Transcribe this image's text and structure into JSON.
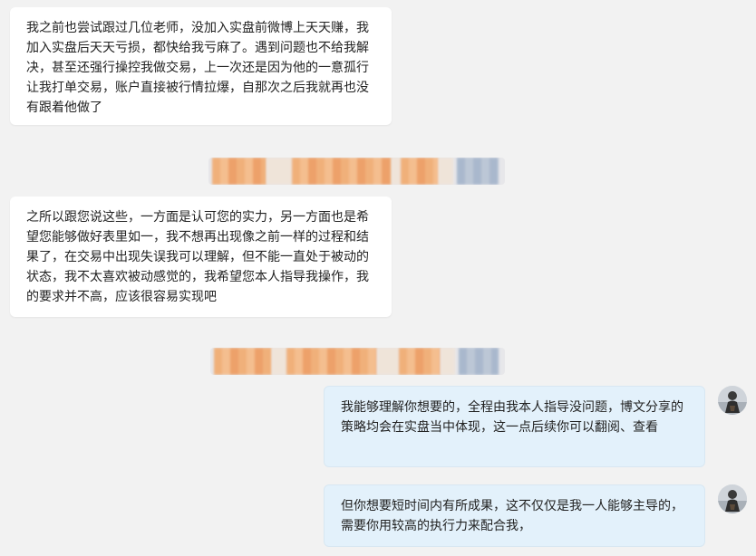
{
  "messages": [
    {
      "side": "in",
      "text": "我之前也尝试跟过几位老师，没加入实盘前微博上天天赚，我加入实盘后天天亏损，都快给我亏麻了。遇到问题也不给我解决，甚至还强行操控我做交易，上一次还是因为他的一意孤行让我打单交易，账户直接被行情拉爆，自那次之后我就再也没有跟着他做了"
    },
    {
      "side": "in",
      "text": "之所以跟您说这些，一方面是认可您的实力，另一方面也是希望您能够做好表里如一，我不想再出现像之前一样的过程和结果了，在交易中出现失误我可以理解，但不能一直处于被动的状态，我不太喜欢被动感觉的，我希望您本人指导我操作，我的要求并不高，应该很容易实现吧"
    },
    {
      "side": "out",
      "text": "我能够理解你想要的，全程由我本人指导没问题，博文分享的策略均会在实盘当中体现，这一点后续你可以翻阅、查看"
    },
    {
      "side": "out",
      "text": "但你想要短时间内有所成果，这不仅仅是我一人能够主导的，需要你用较高的执行力来配合我，"
    }
  ],
  "colors": {
    "background": "#f2f2f2",
    "incoming_bubble": "#ffffff",
    "outgoing_bubble": "#e3f1fb"
  },
  "icons": {
    "avatar": "user-avatar-icon"
  }
}
